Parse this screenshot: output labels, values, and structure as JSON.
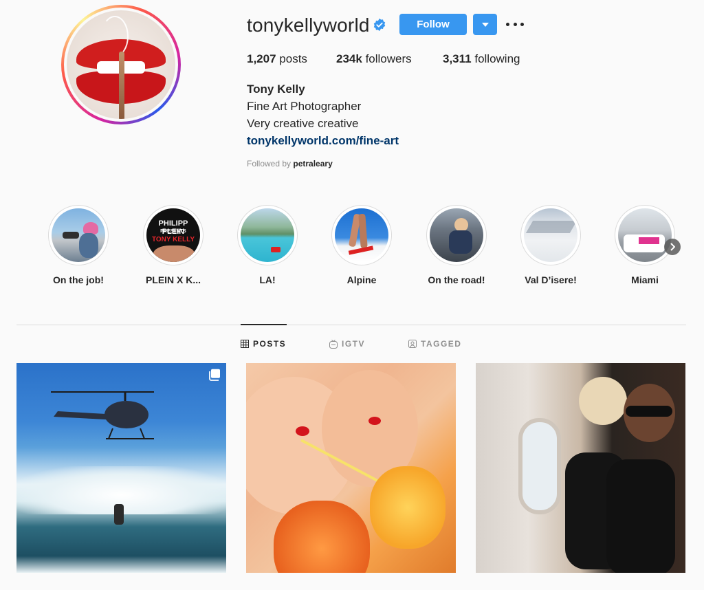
{
  "profile": {
    "username": "tonykellyworld",
    "follow_label": "Follow",
    "stats": {
      "posts_count": "1,207",
      "posts_label": "posts",
      "followers_count": "234k",
      "followers_label": "followers",
      "following_count": "3,311",
      "following_label": "following"
    },
    "bio": {
      "name": "Tony Kelly",
      "line1": "Fine Art Photographer",
      "line2": "Very creative creative",
      "link": "tonykellyworld.com/fine-art"
    },
    "followed_by_prefix": "Followed by",
    "followed_by_user": "petraleary"
  },
  "highlights": [
    {
      "label": "On the job!"
    },
    {
      "label": "PLEIN X K..."
    },
    {
      "label": "LA!"
    },
    {
      "label": "Alpine"
    },
    {
      "label": "On the road!"
    },
    {
      "label": "Val D’isere!"
    },
    {
      "label": "Miami"
    }
  ],
  "highlight_text": {
    "plein_line1": "PHILIPP PLEIN",
    "plein_line2": "PRESENTS",
    "plein_line3": "TONY KELLY"
  },
  "tabs": [
    {
      "label": "POSTS",
      "active": true
    },
    {
      "label": "IGTV",
      "active": false
    },
    {
      "label": "TAGGED",
      "active": false
    }
  ],
  "colors": {
    "accent": "#3897f0",
    "link": "#003569",
    "text": "#262626",
    "muted": "#8e8e8e"
  }
}
